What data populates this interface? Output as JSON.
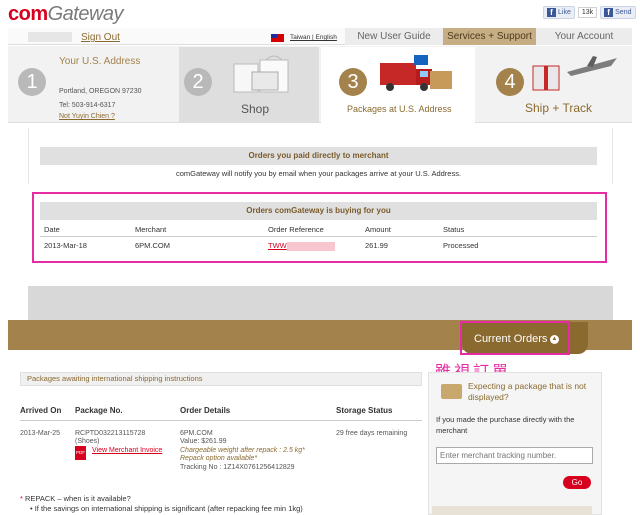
{
  "header": {
    "logo_com": "com",
    "logo_gateway": "Gateway",
    "fb_like": "Like",
    "fb_count": "13k",
    "fb_send": "Send"
  },
  "topbar": {
    "signout": "Sign Out",
    "lang": "Taiwan | English",
    "nav": [
      "New User Guide",
      "Services + Support",
      "Your Account"
    ]
  },
  "steps": {
    "s1": {
      "num": "1",
      "title": "Your U.S. Address",
      "city": "Portland, OREGON 97230",
      "tel": "Tel: 503-914-6317",
      "not_link": "Not Yuyin Chien ?"
    },
    "s2": {
      "num": "2",
      "label": "Shop"
    },
    "s3": {
      "num": "3",
      "label": "Packages at U.S. Address"
    },
    "s4": {
      "num": "4",
      "label": "Ship + Track"
    }
  },
  "direct": {
    "header": "Orders you paid directly to merchant",
    "notify": "comGateway will notify you by email when your packages arrive at your U.S. Address."
  },
  "buying": {
    "header": "Orders comGateway is buying for you",
    "columns": [
      "Date",
      "Merchant",
      "Order Reference",
      "Amount",
      "Status"
    ],
    "row": {
      "date": "2013-Mar-18",
      "merchant": "6PM.COM",
      "ref": "TWW",
      "amount": "261.99",
      "status": "Processed"
    }
  },
  "current_orders": {
    "label": "Current Orders",
    "arrow": "▲",
    "annotation": "雖視訂單"
  },
  "pending": {
    "header": "Packages awaiting international shipping instructions",
    "columns": [
      "Arrived On",
      "Package No.",
      "Order Details",
      "Storage Status"
    ],
    "row": {
      "arrived": "2013-Mar-25",
      "package_no": "RCPTD032213115728",
      "package_type": "(Shoes)",
      "invoice_link": "View Merchant Invoice",
      "pdf": "PDF",
      "merchant": "6PM.COM",
      "value": "Value: $261.99",
      "weight": "Chargeable weight after repack : 2.5 kg*",
      "repack": "Repack option available*",
      "tracking": "Tracking No : 1Z14X0761256412829",
      "storage": "29 free days remaining"
    }
  },
  "notes": {
    "repack_q": "REPACK – when is it available?",
    "bullet": "If the savings on international shipping is significant (after repacking fee min 1kg)"
  },
  "expect": {
    "title": "Expecting a package that is not displayed?",
    "help": "If you made the purchase directly with the merchant",
    "placeholder": "Enter merchant tracking number.",
    "go": "Go"
  }
}
